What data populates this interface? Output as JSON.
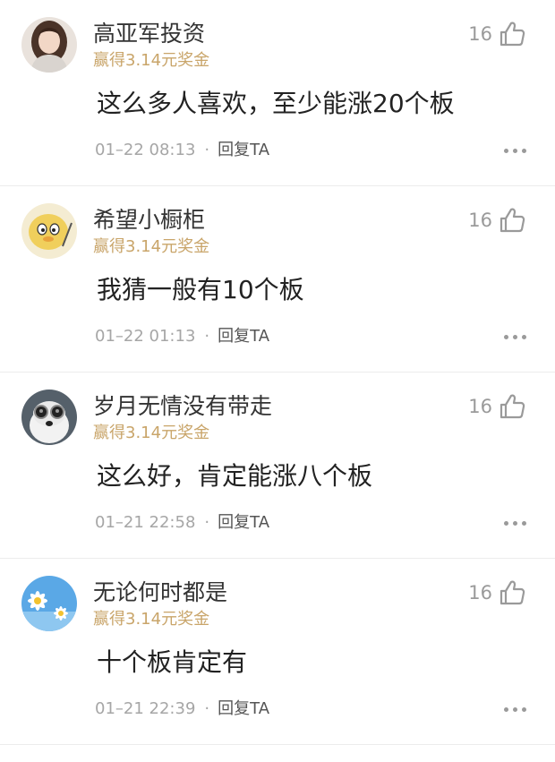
{
  "comments": [
    {
      "user": "高亚军投资",
      "reward": "赢得3.14元奖金",
      "likes": "16",
      "content": "这么多人喜欢，至少能涨20个板",
      "time": "01–22 08:13",
      "reply": "回复TA"
    },
    {
      "user": "希望小橱柜",
      "reward": "赢得3.14元奖金",
      "likes": "16",
      "content": "我猜一般有10个板",
      "time": "01–22 01:13",
      "reply": "回复TA"
    },
    {
      "user": "岁月无情没有带走",
      "reward": "赢得3.14元奖金",
      "likes": "16",
      "content": "这么好，肯定能涨八个板",
      "time": "01–21 22:58",
      "reply": "回复TA"
    },
    {
      "user": "无论何时都是",
      "reward": "赢得3.14元奖金",
      "likes": "16",
      "content": "十个板肯定有",
      "time": "01–21 22:39",
      "reply": "回复TA"
    }
  ],
  "separator": "·",
  "icons": {
    "like": "thumbs-up-icon",
    "more": "more-dots-icon"
  },
  "colors": {
    "reward": "#c9a56a",
    "text": "#222222",
    "meta": "#a6a6a6",
    "icon": "#9a9a9a"
  }
}
